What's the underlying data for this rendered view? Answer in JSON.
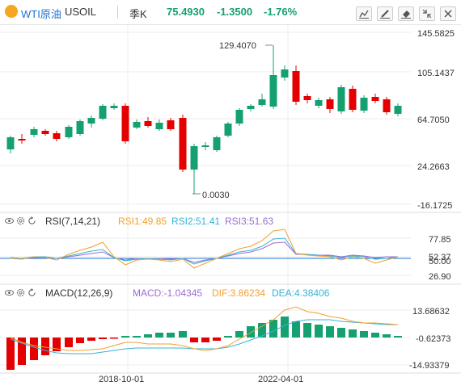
{
  "header": {
    "symbol_name": "WTI原油",
    "symbol_code": "USOIL",
    "period": "季K",
    "price": "75.4930",
    "change": "-1.3500",
    "change_pct": "-1.76%",
    "colors": {
      "accent": "#1e73d6",
      "up": "#e40000",
      "down": "#14a06f",
      "period": "#333333"
    }
  },
  "toolbar": {
    "icons": [
      "line-chart-icon",
      "draw-icon",
      "erase-icon",
      "collapse-icon",
      "close-icon"
    ]
  },
  "price_axis": {
    "ticks": [
      "145.5825",
      "105.1437",
      "64.7050",
      "24.2663",
      "-16.1725"
    ]
  },
  "annotations": {
    "high": "129.4070",
    "low": "0.0030"
  },
  "rsi": {
    "title": "RSI(7,14,21)",
    "rsi1": "RSI1:49.85",
    "rsi2": "RSI2:51.41",
    "rsi3": "RSI3:51.63",
    "ticks": [
      "77.85",
      "52.37",
      "50.00",
      "26.90"
    ],
    "colors": {
      "rsi1": "#f0a030",
      "rsi2": "#35b3d6",
      "rsi3": "#9b6bd0"
    }
  },
  "macd": {
    "title": "MACD(12,26,9)",
    "macd": "MACD:-1.04345",
    "dif": "DIF:3.86234",
    "dea": "DEA:4.38406",
    "ticks": [
      "13.68632",
      "-0.62373",
      "-14.93379"
    ],
    "colors": {
      "macd": "#9b6bd0",
      "dif": "#f0a030",
      "dea": "#35b3d6"
    }
  },
  "time_axis": {
    "labels": [
      "2018-10-01",
      "2022-04-01"
    ]
  }
}
